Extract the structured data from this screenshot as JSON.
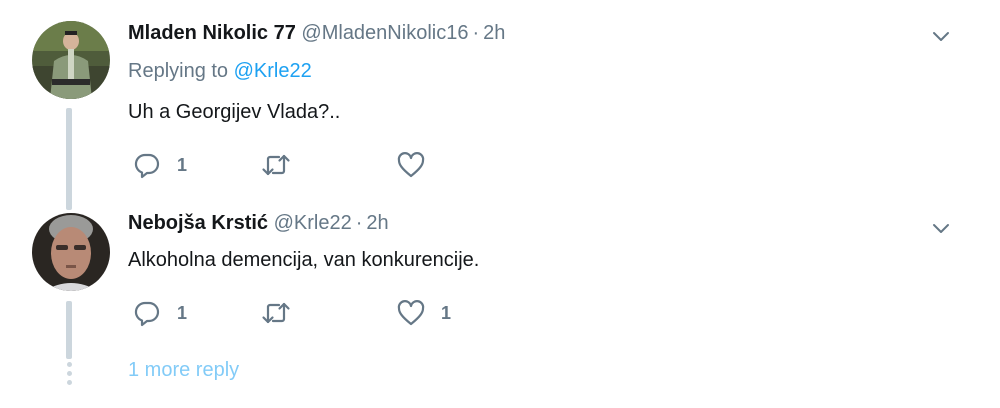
{
  "tweets": [
    {
      "fullname": "Mladen Nikolic 77",
      "username": "@MladenNikolic16",
      "separator": "·",
      "time": "2h",
      "replying_label": "Replying to",
      "replying_to": "@Krle22",
      "text": "Uh a Georgijev Vlada?..",
      "reply_count": "1",
      "retweet_count": "",
      "like_count": ""
    },
    {
      "fullname": "Nebojša Krstić",
      "username": "@Krle22",
      "separator": "·",
      "time": "2h",
      "text": "Alkoholna demencija, van konkurencije.",
      "reply_count": "1",
      "retweet_count": "",
      "like_count": "1"
    }
  ],
  "more_replies": {
    "label": "1 more reply"
  },
  "colors": {
    "link": "#1da1f2",
    "secondary_text": "#657786",
    "icon": "#657786",
    "thread_line": "#ccd6dd"
  },
  "icons": {
    "reply": "reply-icon",
    "retweet": "retweet-icon",
    "like": "heart-icon",
    "menu": "chevron-down-icon"
  }
}
